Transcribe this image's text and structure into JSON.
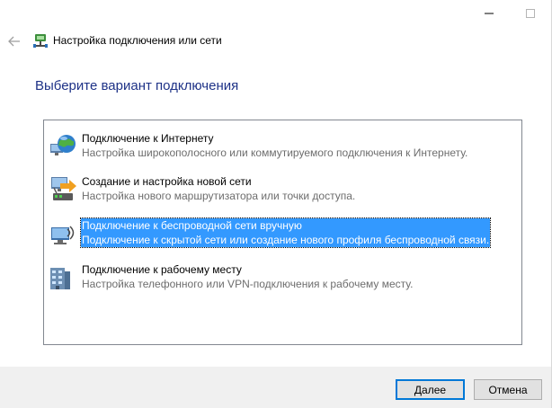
{
  "window": {
    "title": "Настройка подключения или сети",
    "controls": {
      "minimize_icon": "minimize-icon",
      "maximize_icon": "maximize-icon"
    }
  },
  "heading": "Выберите вариант подключения",
  "options": [
    {
      "icon": "globe-network-icon",
      "title": "Подключение к Интернету",
      "description": "Настройка широкополосного или коммутируемого подключения к Интернету.",
      "selected": false
    },
    {
      "icon": "router-setup-icon",
      "title": "Создание и настройка новой сети",
      "description": "Настройка нового маршрутизатора или точки доступа.",
      "selected": false
    },
    {
      "icon": "wireless-computer-icon",
      "title": "Подключение к беспроводной сети вручную",
      "description": "Подключение к скрытой сети или создание нового профиля беспроводной связи.",
      "selected": true
    },
    {
      "icon": "workplace-building-icon",
      "title": "Подключение к рабочему месту",
      "description": "Настройка телефонного или VPN-подключения к рабочему месту.",
      "selected": false
    }
  ],
  "footer": {
    "next_label": "Далее",
    "cancel_label": "Отмена"
  },
  "colors": {
    "heading": "#1e3287",
    "selection": "#3399ff",
    "default_button_border": "#0078d7",
    "footer_bg": "#f0f0f0"
  }
}
